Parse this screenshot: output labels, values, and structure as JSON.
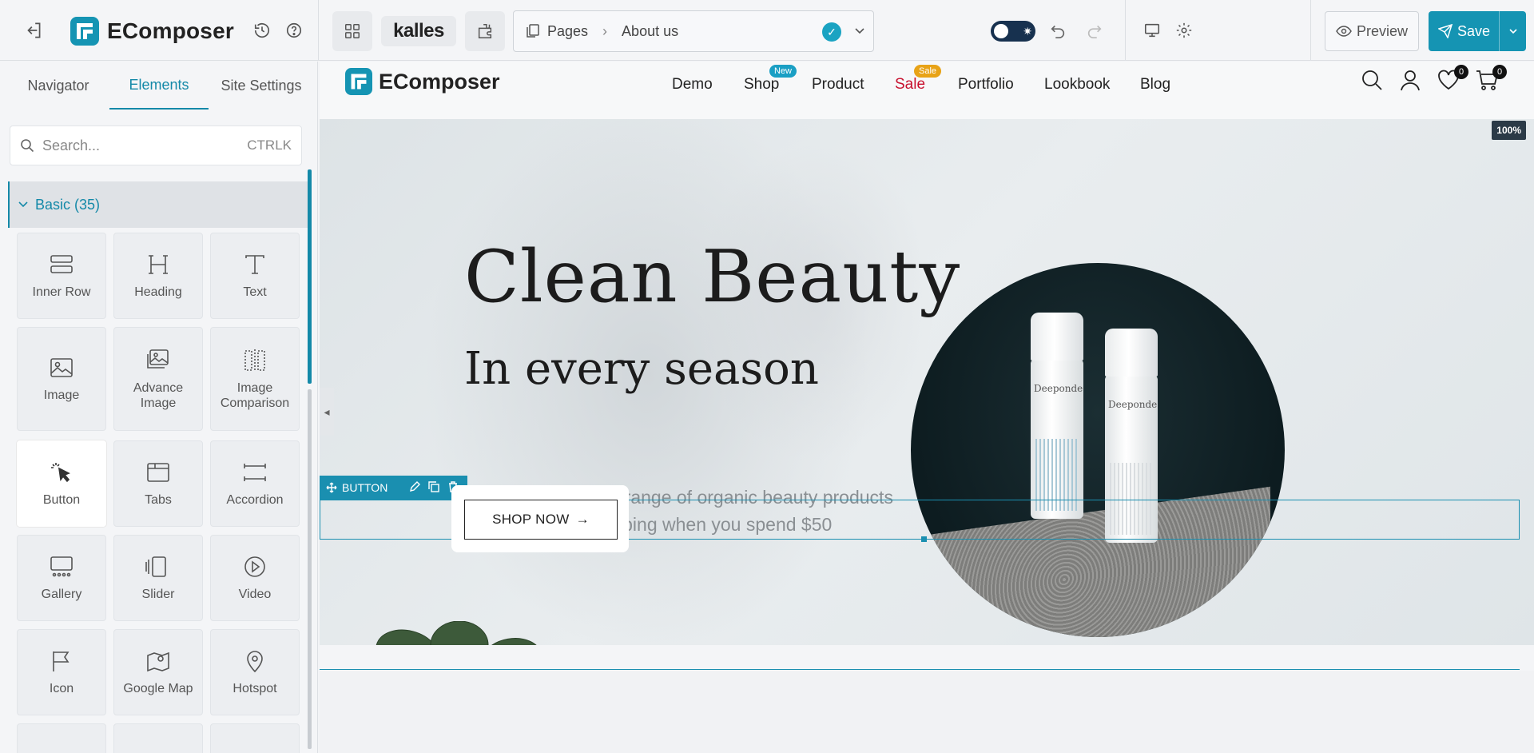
{
  "app": {
    "brand": "EComposer",
    "theme_name": "kalles",
    "breadcrumb": {
      "section": "Pages",
      "page": "About us"
    },
    "preview_label": "Preview",
    "save_label": "Save"
  },
  "sidebar": {
    "tabs": [
      "Navigator",
      "Elements",
      "Site Settings"
    ],
    "active_tab": "Elements",
    "search": {
      "placeholder": "Search...",
      "shortcut": "CTRLK"
    },
    "category": "Basic (35)",
    "elements": [
      {
        "label": "Inner Row",
        "icon": "inner-row-icon"
      },
      {
        "label": "Heading",
        "icon": "heading-icon"
      },
      {
        "label": "Text",
        "icon": "text-icon"
      },
      {
        "label": "Image",
        "icon": "image-icon"
      },
      {
        "label": "Advance Image",
        "icon": "advance-image-icon"
      },
      {
        "label": "Image Comparison",
        "icon": "image-comparison-icon"
      },
      {
        "label": "Button",
        "icon": "button-cursor-icon"
      },
      {
        "label": "Tabs",
        "icon": "tabs-icon"
      },
      {
        "label": "Accordion",
        "icon": "accordion-icon"
      },
      {
        "label": "Gallery",
        "icon": "gallery-icon"
      },
      {
        "label": "Slider",
        "icon": "slider-icon"
      },
      {
        "label": "Video",
        "icon": "video-icon"
      },
      {
        "label": "Icon",
        "icon": "flag-icon"
      },
      {
        "label": "Google Map",
        "icon": "map-icon"
      },
      {
        "label": "Hotspot",
        "icon": "pin-icon"
      }
    ]
  },
  "store": {
    "logo": "EComposer",
    "nav": [
      {
        "label": "Demo"
      },
      {
        "label": "Shop",
        "badge": "New",
        "badge_color": "#1a9fc4"
      },
      {
        "label": "Product"
      },
      {
        "label": "Sale",
        "badge": "Sale",
        "badge_color": "#e8a317",
        "highlight": "#c8102e"
      },
      {
        "label": "Portfolio"
      },
      {
        "label": "Lookbook"
      },
      {
        "label": "Blog"
      }
    ],
    "wishlist_count": "0",
    "cart_count": "0"
  },
  "canvas": {
    "zoom": "100%",
    "hero": {
      "title": "Clean Beauty",
      "subtitle": "In every season",
      "line1": "Discover awesome range of organic beauty products",
      "line2": "Free sample & shipping when you spend $50",
      "cta": "SHOP NOW",
      "cta_arrow": "→",
      "bottle_brand": "Deeponde"
    },
    "selected_element": "BUTTON"
  },
  "colors": {
    "accent": "#1594b3",
    "sale_red": "#c8102e",
    "new_badge": "#1a9fc4",
    "sale_badge": "#e8a317"
  }
}
